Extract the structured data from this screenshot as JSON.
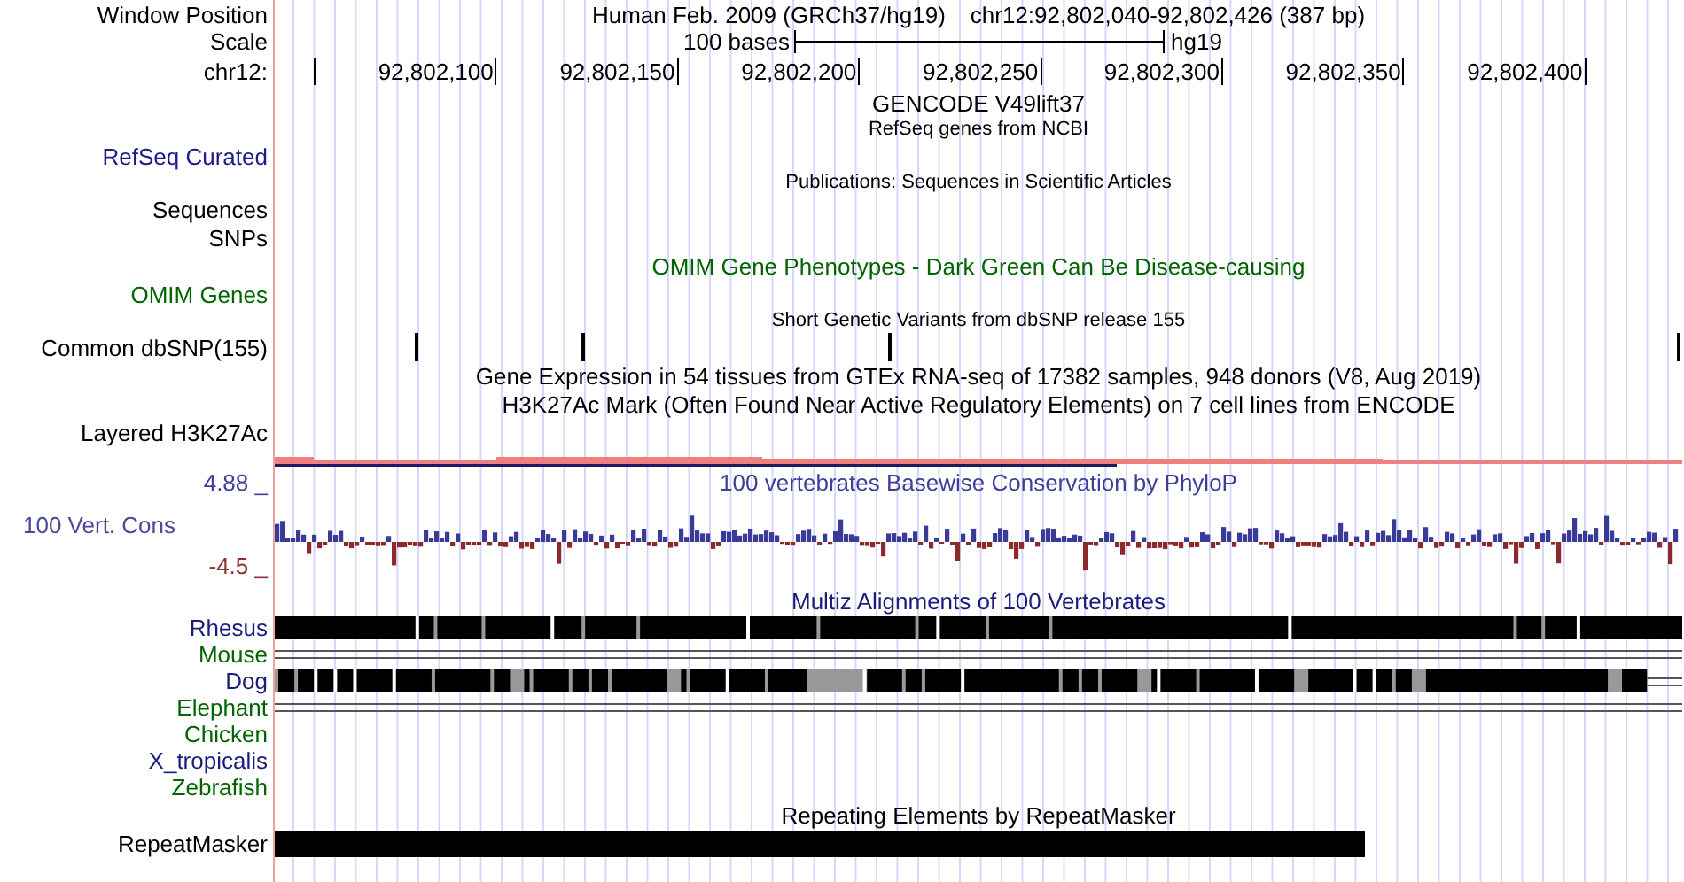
{
  "rows": [
    {
      "kind": "position",
      "label": "Window Position",
      "text": "Human Feb. 2009 (GRCh37/hg19)",
      "range": "chr12:92,802,040-92,802,426 (387 bp)"
    },
    {
      "kind": "scale",
      "label": "Scale",
      "text": "100 bases",
      "assembly": "hg19"
    },
    {
      "kind": "ruler",
      "label": "chr12:",
      "ticks": [
        "92,802,100",
        "92,802,150",
        "92,802,200",
        "92,802,250",
        "92,802,300",
        "92,802,350",
        "92,802,400"
      ]
    },
    {
      "kind": "title",
      "title": "GENCODE V49lift37",
      "small": false
    },
    {
      "kind": "title",
      "title": "RefSeq genes from NCBI",
      "small": true
    },
    {
      "kind": "label",
      "label": "RefSeq Curated",
      "color": "#1c1c8c"
    },
    {
      "kind": "title",
      "title": "Publications: Sequences in Scientific Articles",
      "small": true
    },
    {
      "kind": "label",
      "label": "Sequences",
      "color": "#000000"
    },
    {
      "kind": "label",
      "label": "SNPs",
      "color": "#000000"
    },
    {
      "kind": "title",
      "title": "OMIM Gene Phenotypes - Dark Green Can Be Disease-causing",
      "small": false,
      "color": "#006400"
    },
    {
      "kind": "label",
      "label": "OMIM Genes",
      "color": "#006400"
    },
    {
      "kind": "title",
      "title": "Short Genetic Variants from dbSNP release 155",
      "small": true
    },
    {
      "kind": "snp",
      "label": "Common dbSNP(155)"
    },
    {
      "kind": "title",
      "title": "Gene Expression in 54 tissues from GTEx RNA-seq of 17382 samples, 948 donors (V8, Aug 2019)",
      "small": false
    },
    {
      "kind": "title",
      "title": "H3K27Ac Mark (Often Found Near Active Regulatory Elements) on 7 cell lines from ENCODE",
      "small": false
    },
    {
      "kind": "label",
      "label": "Layered H3K27Ac",
      "color": "#000000"
    },
    {
      "kind": "layered"
    },
    {
      "kind": "wig-title",
      "label": "4.88 _",
      "title": "100 vertebrates Basewise Conservation by PhyloP",
      "color": "#3f3f99"
    },
    {
      "kind": "wiggle",
      "label": "100 Vert. Cons",
      "min_label": "-4.5 _",
      "color": "#4b4b9b"
    },
    {
      "kind": "title",
      "title": "Multiz Alignments of 100 Vertebrates",
      "small": false,
      "color": "#1c1c7c"
    },
    {
      "kind": "full",
      "label": "Rhesus",
      "color": "#1c1c7c"
    },
    {
      "kind": "lines",
      "label": "Mouse",
      "color": "#006400"
    },
    {
      "kind": "partial",
      "label": "Dog",
      "color": "#1c1c7c"
    },
    {
      "kind": "lines",
      "label": "Elephant",
      "color": "#006400"
    },
    {
      "kind": "empty",
      "label": "Chicken",
      "color": "#006400"
    },
    {
      "kind": "empty",
      "label": "X_tropicalis",
      "color": "#1c1c7c"
    },
    {
      "kind": "empty",
      "label": "Zebrafish",
      "color": "#006400"
    },
    {
      "kind": "title",
      "title": "Repeating Elements by RepeatMasker",
      "small": false
    },
    {
      "kind": "repeat",
      "label": "RepeatMasker"
    }
  ]
}
